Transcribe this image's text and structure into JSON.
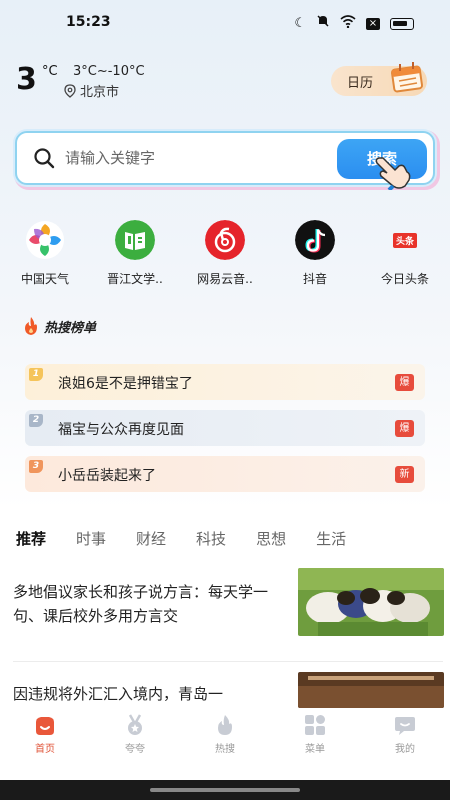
{
  "status_bar": {
    "time": "15:23"
  },
  "weather": {
    "temp": "3",
    "unit": "°C",
    "range": "3°C~-10°C",
    "city": "北京市"
  },
  "calendar": {
    "label": "日历"
  },
  "search": {
    "placeholder": "请输入关键字",
    "button_label": "搜索"
  },
  "apps": [
    {
      "label": "中国天气",
      "icon": "china-weather-icon"
    },
    {
      "label": "晋江文学..",
      "icon": "jinjiang-literature-icon"
    },
    {
      "label": "网易云音..",
      "icon": "netease-music-icon"
    },
    {
      "label": "抖音",
      "icon": "douyin-icon"
    },
    {
      "label": "今日头条",
      "icon": "toutiao-icon",
      "icon_text": "头条"
    }
  ],
  "hot_search": {
    "title": "热搜榜单",
    "items": [
      {
        "rank": "1",
        "text": "浪姐6是不是押错宝了",
        "badge": "爆"
      },
      {
        "rank": "2",
        "text": "福宝与公众再度见面",
        "badge": "爆"
      },
      {
        "rank": "3",
        "text": "小岳岳装起来了",
        "badge": "新"
      }
    ]
  },
  "tabs": [
    "推荐",
    "时事",
    "财经",
    "科技",
    "思想",
    "生活"
  ],
  "news": [
    {
      "title": "多地倡议家长和孩子说方言：每天学一句、课后校外多用方言交"
    },
    {
      "title": "因违规将外汇汇入境内，青岛一"
    }
  ],
  "bottom_nav": [
    {
      "label": "首页",
      "icon": "home-icon"
    },
    {
      "label": "夸夸",
      "icon": "medal-icon"
    },
    {
      "label": "热搜",
      "icon": "flame-icon"
    },
    {
      "label": "菜单",
      "icon": "grid-menu-icon"
    },
    {
      "label": "我的",
      "icon": "chat-bubble-icon"
    }
  ],
  "colors": {
    "accent": "#2b8ef0",
    "hot_red": "#e74c3c",
    "active_nav": "#e0553a"
  }
}
